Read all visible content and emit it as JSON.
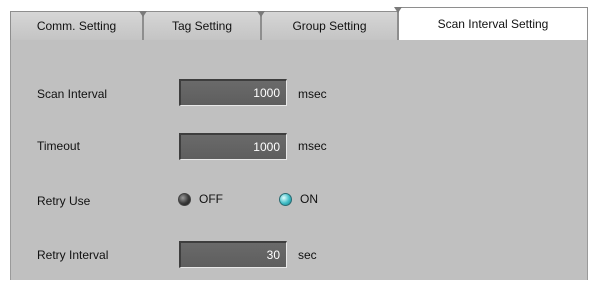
{
  "tabs": [
    {
      "label": "Comm. Setting",
      "active": false
    },
    {
      "label": "Tag Setting",
      "active": false
    },
    {
      "label": "Group Setting",
      "active": false
    },
    {
      "label": "Scan Interval Setting",
      "active": true
    }
  ],
  "form": {
    "scan_interval": {
      "label": "Scan Interval",
      "value": "1000",
      "unit": "msec"
    },
    "timeout": {
      "label": "Timeout",
      "value": "1000",
      "unit": "msec"
    },
    "retry_use": {
      "label": "Retry Use",
      "off_label": "OFF",
      "on_label": "ON",
      "selected": "ON"
    },
    "retry_interval": {
      "label": "Retry Interval",
      "value": "30",
      "unit": "sec"
    }
  },
  "colors": {
    "panel_bg": "#c0c0c0",
    "field_bg": "#666666",
    "radio_on": "#3fbcc6",
    "radio_off": "#3a3a3a"
  }
}
